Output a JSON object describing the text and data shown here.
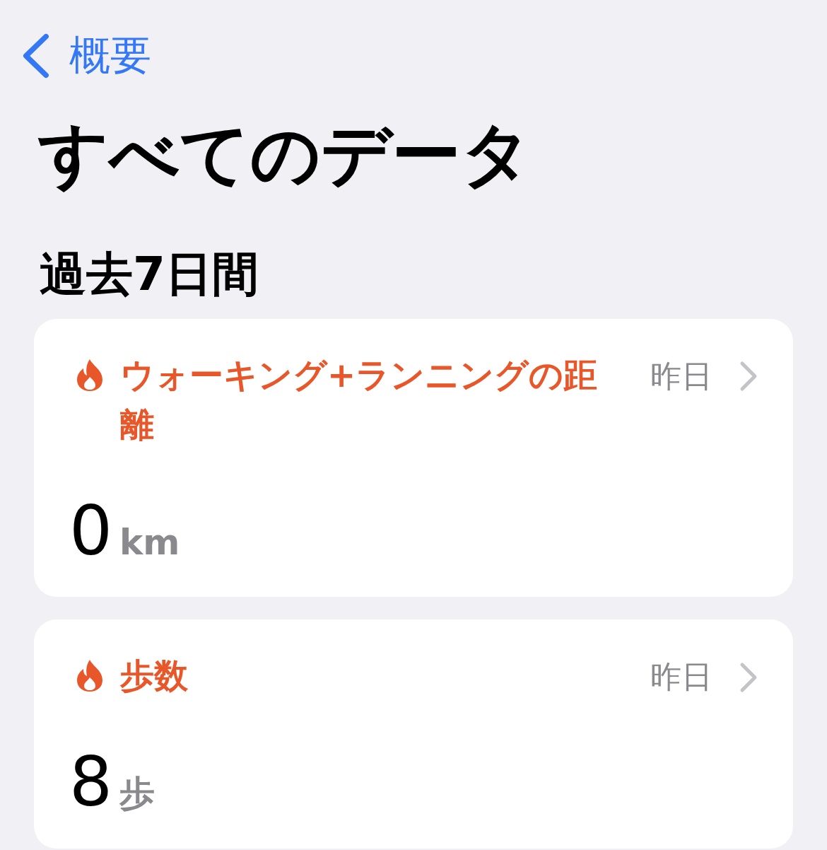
{
  "nav": {
    "back_label": "概要"
  },
  "title": "すべてのデータ",
  "section": {
    "title": "過去7日間"
  },
  "cards": [
    {
      "title": "ウォーキング+ランニングの距離",
      "date": "昨日",
      "value": "0",
      "unit": "km"
    },
    {
      "title": "歩数",
      "date": "昨日",
      "value": "8",
      "unit": "歩"
    }
  ]
}
